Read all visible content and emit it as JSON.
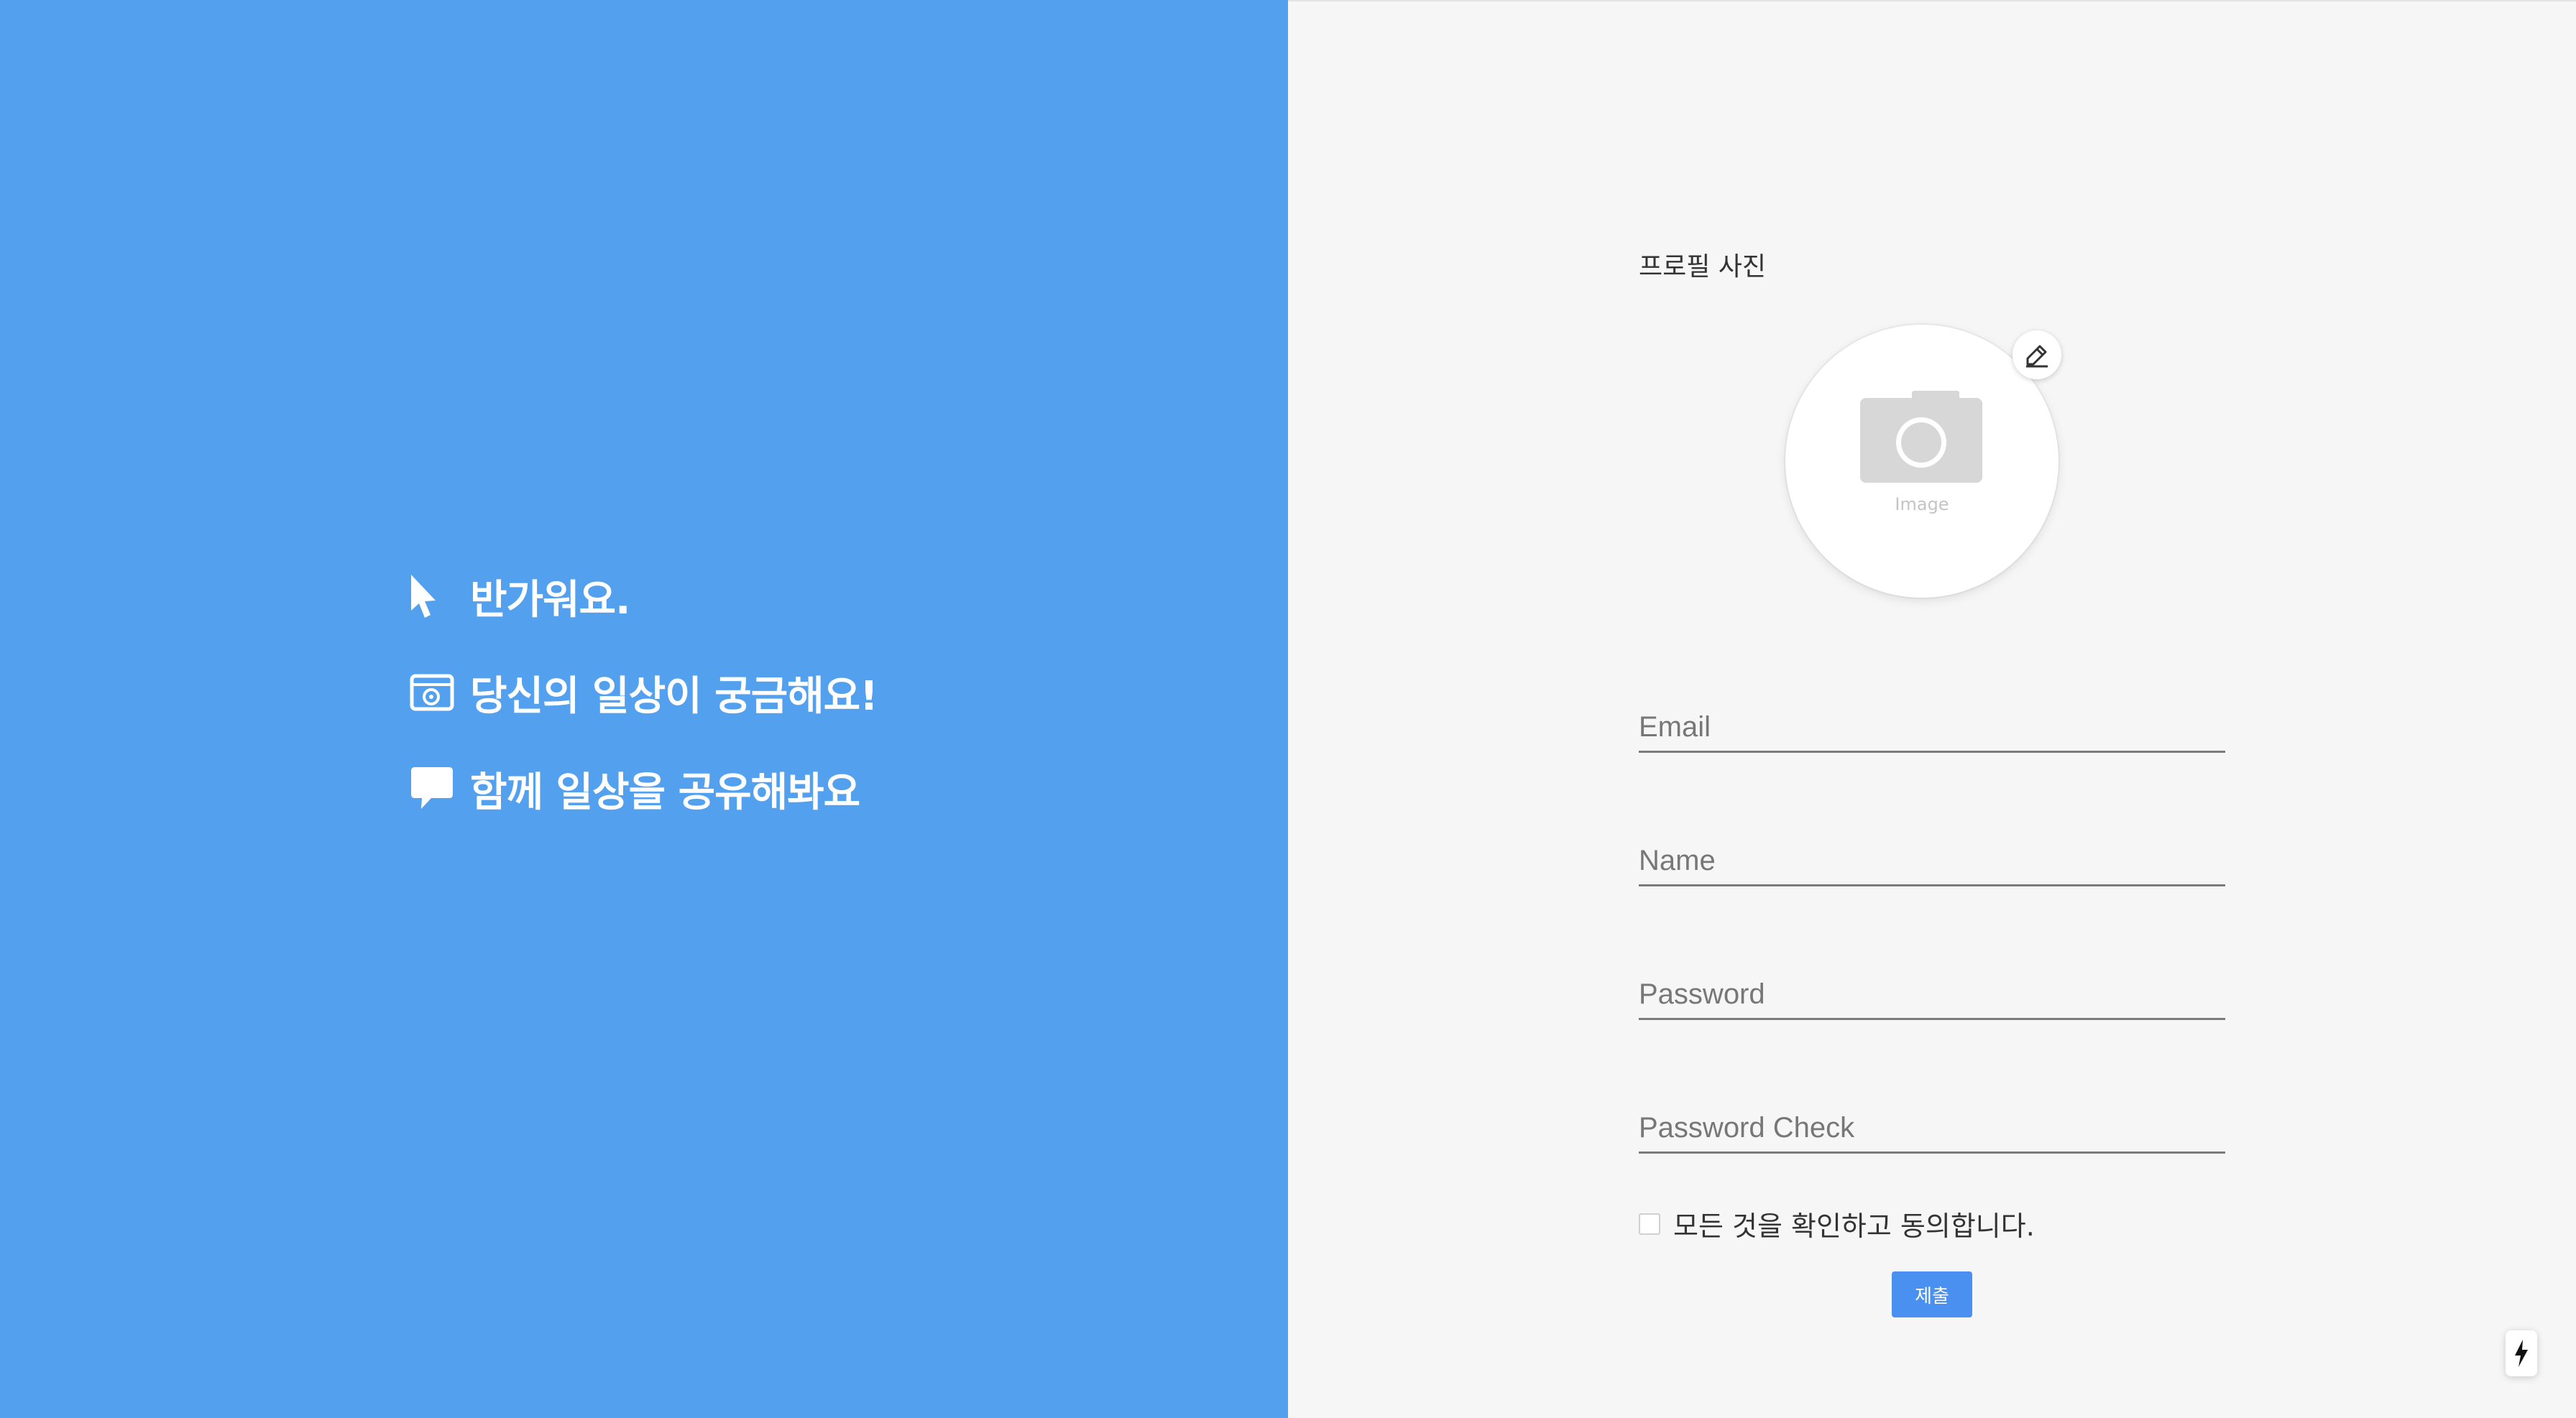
{
  "left_panel": {
    "background_color": "#52a0ee",
    "items": [
      {
        "icon": "cursor-pointer-icon",
        "text": "반가워요."
      },
      {
        "icon": "photo-frame-icon",
        "text": "당신의 일상이 궁금해요!"
      },
      {
        "icon": "chat-bubble-icon",
        "text": "함께 일상을 공유해봐요"
      }
    ]
  },
  "form": {
    "profile_label": "프로필 사진",
    "avatar_caption": "Image",
    "avatar_icon": "camera-icon",
    "edit_icon": "pencil-icon",
    "fields": {
      "email_placeholder": "Email",
      "name_placeholder": "Name",
      "password_placeholder": "Password",
      "password_check_placeholder": "Password Check"
    },
    "agree_label": "모든 것을 확인하고 동의합니다.",
    "agree_checked": false,
    "submit_label": "제출",
    "accent_color": "#4a90f0"
  },
  "floating_button": {
    "icon": "lightning-icon"
  }
}
